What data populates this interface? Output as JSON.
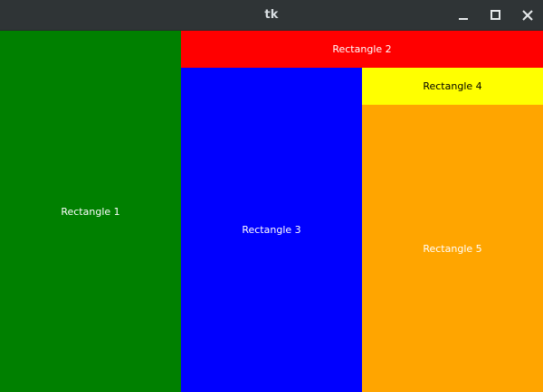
{
  "window": {
    "title": "tk"
  },
  "titlebar_controls": {
    "minimize_icon": "minimize-icon",
    "maximize_icon": "maximize-icon",
    "close_icon": "close-icon"
  },
  "rectangles": [
    {
      "label": "Rectangle 1",
      "color": "#008000",
      "text_color": "#ffffff"
    },
    {
      "label": "Rectangle 2",
      "color": "#ff0000",
      "text_color": "#ffffff"
    },
    {
      "label": "Rectangle 3",
      "color": "#0000ff",
      "text_color": "#ffffff"
    },
    {
      "label": "Rectangle 4",
      "color": "#ffff00",
      "text_color": "#000000"
    },
    {
      "label": "Rectangle 5",
      "color": "#ffa500",
      "text_color": "#ffffff"
    }
  ]
}
